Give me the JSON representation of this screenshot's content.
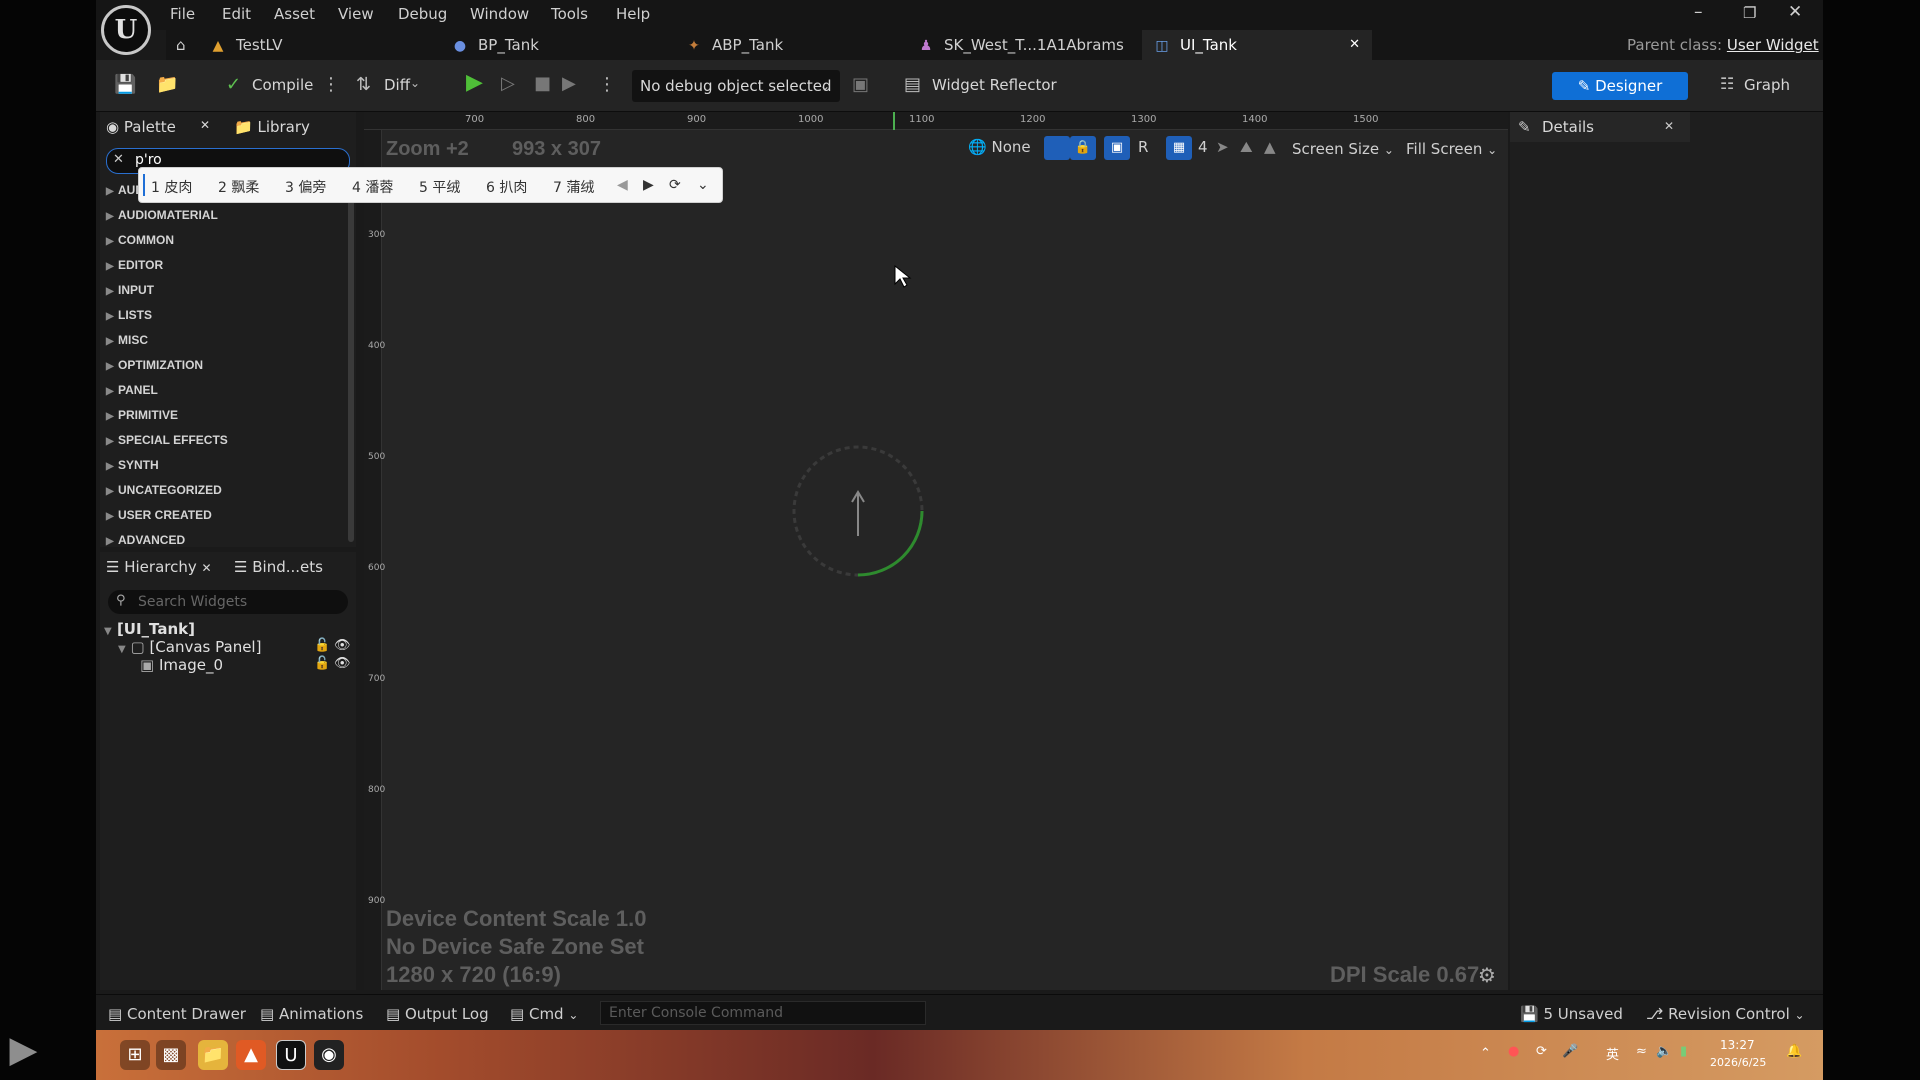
{
  "menu": [
    "File",
    "Edit",
    "Asset",
    "View",
    "Debug",
    "Window",
    "Tools",
    "Help"
  ],
  "tabs": [
    {
      "label": "TestLV",
      "icon": "level-icon"
    },
    {
      "label": "BP_Tank",
      "icon": "blueprint-icon"
    },
    {
      "label": "ABP_Tank",
      "icon": "anim-blueprint-icon"
    },
    {
      "label": "SK_West_T...1A1Abrams",
      "icon": "skeleton-icon"
    },
    {
      "label": "UI_Tank",
      "icon": "widget-blueprint-icon"
    }
  ],
  "parent_class": {
    "label": "Parent class:",
    "value": "User Widget"
  },
  "toolbar": {
    "compile": "Compile",
    "diff": "Diff",
    "debug_select": "No debug object selected",
    "widget_reflector": "Widget Reflector",
    "designer": "Designer",
    "graph": "Graph"
  },
  "palette": {
    "tab_palette": "Palette",
    "tab_library": "Library",
    "search_value": "p'ro",
    "categories": [
      "AUDIO",
      "AUDIOMATERIAL",
      "COMMON",
      "EDITOR",
      "INPUT",
      "LISTS",
      "MISC",
      "OPTIMIZATION",
      "PANEL",
      "PRIMITIVE",
      "SPECIAL EFFECTS",
      "SYNTH",
      "UNCATEGORIZED",
      "USER CREATED",
      "ADVANCED"
    ]
  },
  "ime": {
    "candidates": [
      "1 皮肉",
      "2 飘柔",
      "3 偏旁",
      "4 潘蓉",
      "5 平绒",
      "6 扒肉",
      "7 蒲绒"
    ]
  },
  "hierarchy": {
    "tab_hierarchy": "Hierarchy",
    "tab_bindings": "Bind...ets",
    "search_placeholder": "Search Widgets",
    "root": "[UI_Tank]",
    "canvas_panel": "[Canvas Panel]",
    "image": "Image_0"
  },
  "canvas": {
    "zoom": "Zoom +2",
    "size": "993 x 307",
    "top_ruler": [
      "700",
      "800",
      "900",
      "1000",
      "1100",
      "1200",
      "1300",
      "1400",
      "1500"
    ],
    "left_ruler": [
      "300",
      "400",
      "500",
      "600",
      "700",
      "800",
      "900"
    ],
    "localization": "None",
    "r_button": "R",
    "grid_snap": "4",
    "screen_size": "Screen Size",
    "fill_screen": "Fill Screen",
    "device_content_scale": "Device Content Scale 1.0",
    "safe_zone": "No Device Safe Zone Set",
    "resolution": "1280 x 720 (16:9)",
    "dpi_scale": "DPI Scale 0.67"
  },
  "details": {
    "title": "Details"
  },
  "statusbar": {
    "content_drawer": "Content Drawer",
    "animations": "Animations",
    "output_log": "Output Log",
    "cmd": "Cmd",
    "console_placeholder": "Enter Console Command",
    "unsaved": "5 Unsaved",
    "revision_control": "Revision Control"
  },
  "taskbar": {
    "time": "13:27",
    "date": "2026/6/25",
    "ime_indicator": "英"
  },
  "colors": {
    "accent": "#0f6fd6",
    "play_green": "#4fbf38",
    "panel_bg": "#1e1e1e",
    "canvas_bg": "#252525"
  }
}
